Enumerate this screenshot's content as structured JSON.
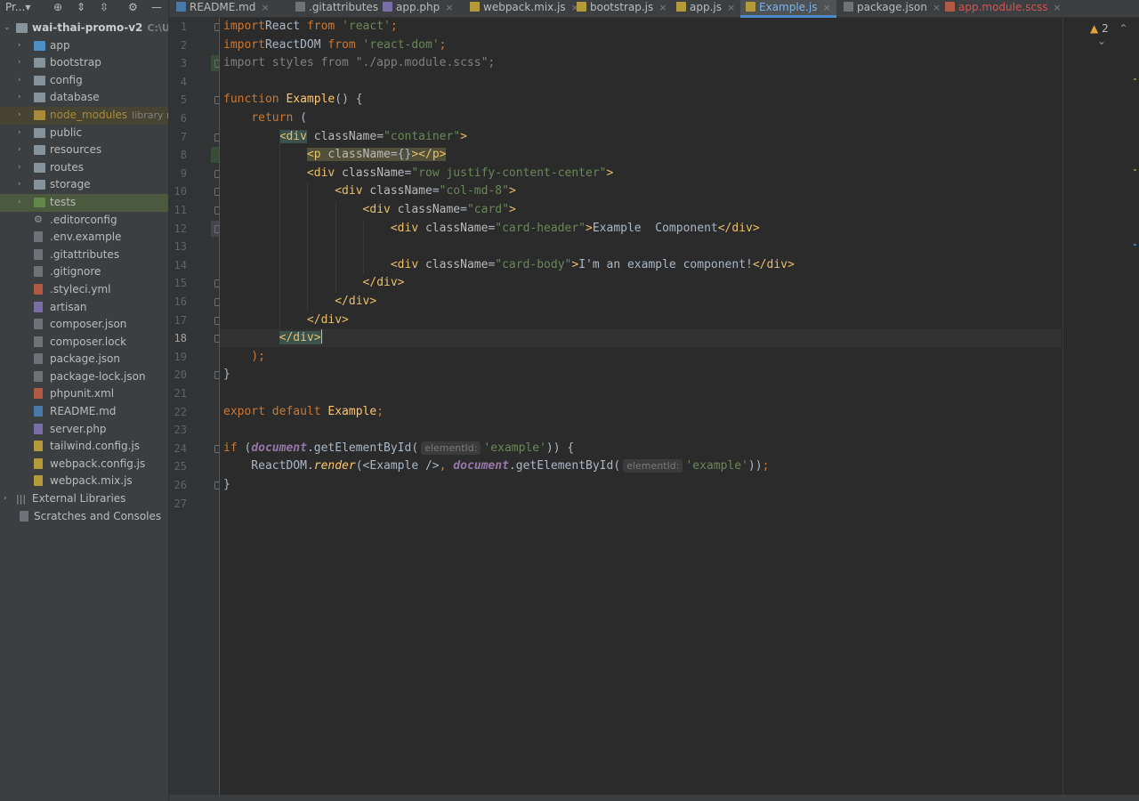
{
  "project_toolbar": {
    "title": "Pr...",
    "dropdown": "▾",
    "icons": [
      "target-icon",
      "expand-all-icon",
      "collapse-all-icon",
      "gear-icon",
      "hide-icon"
    ]
  },
  "tree": [
    {
      "label": "wai-thai-promo-v2",
      "sub": "C:\\Users",
      "indent": 0,
      "chevron": "⌄",
      "icon": "folder"
    },
    {
      "label": "app",
      "indent": 1,
      "chevron": "›",
      "icon": "folder-blue"
    },
    {
      "label": "bootstrap",
      "indent": 1,
      "chevron": "›",
      "icon": "folder"
    },
    {
      "label": "config",
      "indent": 1,
      "chevron": "›",
      "icon": "folder"
    },
    {
      "label": "database",
      "indent": 1,
      "chevron": "›",
      "icon": "folder"
    },
    {
      "label": "node_modules",
      "sub": "library roo",
      "indent": 1,
      "chevron": "›",
      "icon": "folder-orange",
      "excluded": true
    },
    {
      "label": "public",
      "indent": 1,
      "chevron": "›",
      "icon": "folder"
    },
    {
      "label": "resources",
      "indent": 1,
      "chevron": "›",
      "icon": "folder"
    },
    {
      "label": "routes",
      "indent": 1,
      "chevron": "›",
      "icon": "folder"
    },
    {
      "label": "storage",
      "indent": 1,
      "chevron": "›",
      "icon": "folder"
    },
    {
      "label": "tests",
      "indent": 1,
      "chevron": "›",
      "icon": "folder-green",
      "selected": true
    },
    {
      "label": ".editorconfig",
      "indent": 1,
      "icon": "gear"
    },
    {
      "label": ".env.example",
      "indent": 1,
      "icon": "file"
    },
    {
      "label": ".gitattributes",
      "indent": 1,
      "icon": "file"
    },
    {
      "label": ".gitignore",
      "indent": 1,
      "icon": "file"
    },
    {
      "label": ".styleci.yml",
      "indent": 1,
      "icon": "file-red"
    },
    {
      "label": "artisan",
      "indent": 1,
      "icon": "file-purple"
    },
    {
      "label": "composer.json",
      "indent": 1,
      "icon": "file"
    },
    {
      "label": "composer.lock",
      "indent": 1,
      "icon": "file"
    },
    {
      "label": "package.json",
      "indent": 1,
      "icon": "file"
    },
    {
      "label": "package-lock.json",
      "indent": 1,
      "icon": "file"
    },
    {
      "label": "phpunit.xml",
      "indent": 1,
      "icon": "file-red"
    },
    {
      "label": "README.md",
      "indent": 1,
      "icon": "file-blue"
    },
    {
      "label": "server.php",
      "indent": 1,
      "icon": "file-purple"
    },
    {
      "label": "tailwind.config.js",
      "indent": 1,
      "icon": "file-yellow"
    },
    {
      "label": "webpack.config.js",
      "indent": 1,
      "icon": "file-yellow"
    },
    {
      "label": "webpack.mix.js",
      "indent": 1,
      "icon": "file-yellow"
    },
    {
      "label": "External Libraries",
      "indent": 0,
      "chevron": "›",
      "icon": "libraries"
    },
    {
      "label": "Scratches and Consoles",
      "indent": 0,
      "icon": "scratches"
    }
  ],
  "tabs": [
    {
      "label": "README.md",
      "icon": "md",
      "color": "#4a78a8"
    },
    {
      "label": ".gitattributes",
      "icon": "file",
      "color": "#6f7378"
    },
    {
      "label": "app.php",
      "icon": "php",
      "color": "#7a6ea6"
    },
    {
      "label": "webpack.mix.js",
      "icon": "js",
      "color": "#b39b3c"
    },
    {
      "label": "bootstrap.js",
      "icon": "js",
      "color": "#b39b3c"
    },
    {
      "label": "app.js",
      "icon": "js",
      "color": "#b39b3c"
    },
    {
      "label": "Example.js",
      "icon": "js",
      "color": "#b39b3c",
      "active": true
    },
    {
      "label": "package.json",
      "icon": "json",
      "color": "#6f7378"
    },
    {
      "label": "app.module.scss",
      "icon": "scss",
      "color": "#b35a45",
      "error": true
    }
  ],
  "tab_close": "×",
  "editor": {
    "current_line": 18,
    "warnings_count": "2",
    "lines": [
      [
        [
          "kw",
          "import"
        ],
        [
          "",
          "React "
        ],
        [
          "kw",
          "from"
        ],
        [
          "str",
          " 'react'"
        ],
        [
          "kw",
          ";"
        ]
      ],
      [
        [
          "kw",
          "import"
        ],
        [
          "",
          "ReactDOM "
        ],
        [
          "kw",
          "from"
        ],
        [
          "str",
          " 'react-dom'"
        ],
        [
          "kw",
          ";"
        ]
      ],
      [
        [
          "dim",
          "import styles from \"./app.module.scss\";"
        ]
      ],
      [],
      [
        [
          "kw",
          "function "
        ],
        [
          "fn",
          "Example"
        ],
        [
          "",
          "() {"
        ]
      ],
      [
        [
          "",
          "    "
        ],
        [
          "kw",
          "return"
        ],
        [
          "",
          " ("
        ]
      ],
      [
        [
          "",
          "        "
        ],
        [
          "taghl",
          "<div"
        ],
        [
          "attr",
          " className"
        ],
        [
          "",
          "="
        ],
        [
          "str",
          "\"container\""
        ],
        [
          "tag",
          ">"
        ]
      ],
      [
        [
          "",
          "            "
        ],
        [
          "taghl2",
          "<p"
        ],
        [
          "attrhl2",
          " className"
        ],
        [
          "hl2",
          "="
        ],
        [
          "hl2",
          "{}"
        ],
        [
          "taghl2",
          "></p>"
        ]
      ],
      [
        [
          "",
          "            "
        ],
        [
          "tag",
          "<div"
        ],
        [
          "attr",
          " className"
        ],
        [
          "",
          "="
        ],
        [
          "str",
          "\"row justify-content-center\""
        ],
        [
          "tag",
          ">"
        ]
      ],
      [
        [
          "",
          "                "
        ],
        [
          "tag",
          "<div"
        ],
        [
          "attr",
          " className"
        ],
        [
          "",
          "="
        ],
        [
          "str",
          "\"col-md-8\""
        ],
        [
          "tag",
          ">"
        ]
      ],
      [
        [
          "",
          "                    "
        ],
        [
          "tag",
          "<div"
        ],
        [
          "attr",
          " className"
        ],
        [
          "",
          "="
        ],
        [
          "str",
          "\"card\""
        ],
        [
          "tag",
          ">"
        ]
      ],
      [
        [
          "",
          "                        "
        ],
        [
          "tag",
          "<div"
        ],
        [
          "attr",
          " className"
        ],
        [
          "",
          "="
        ],
        [
          "str",
          "\"card-header\""
        ],
        [
          "tag",
          ">"
        ],
        [
          "",
          "Example  Component"
        ],
        [
          "tag",
          "</div>"
        ]
      ],
      [],
      [
        [
          "",
          "                        "
        ],
        [
          "tag",
          "<div"
        ],
        [
          "attr",
          " className"
        ],
        [
          "",
          "="
        ],
        [
          "str",
          "\"card-body\""
        ],
        [
          "tag",
          ">"
        ],
        [
          "",
          "I'm an example component!"
        ],
        [
          "tag",
          "</div>"
        ]
      ],
      [
        [
          "",
          "                    "
        ],
        [
          "tag",
          "</div>"
        ]
      ],
      [
        [
          "",
          "                "
        ],
        [
          "tag",
          "</div>"
        ]
      ],
      [
        [
          "",
          "            "
        ],
        [
          "tag",
          "</div>"
        ]
      ],
      [
        [
          "",
          "        "
        ],
        [
          "taghl",
          "</div>"
        ],
        [
          "caret",
          ""
        ]
      ],
      [
        [
          "",
          "    "
        ],
        [
          "kw",
          ");"
        ]
      ],
      [
        [
          "",
          "}"
        ]
      ],
      [],
      [
        [
          "kw",
          "export default "
        ],
        [
          "fn",
          "Example"
        ],
        [
          "kw",
          ";"
        ]
      ],
      [],
      [
        [
          "kw",
          "if "
        ],
        [
          "",
          "("
        ],
        [
          "ital",
          "document"
        ],
        [
          "",
          ".getElementById("
        ],
        [
          "hint",
          "elementId:"
        ],
        [
          "str",
          "'example'"
        ],
        [
          "",
          "))"
        ],
        [
          "",
          " {"
        ]
      ],
      [
        [
          "",
          "    ReactDOM."
        ],
        [
          "italfn",
          "render"
        ],
        [
          "",
          "(<Example />"
        ],
        [
          "kw",
          ", "
        ],
        [
          "ital",
          "document"
        ],
        [
          "",
          ".getElementById("
        ],
        [
          "hint",
          "elementId:"
        ],
        [
          "str",
          "'example'"
        ],
        [
          "",
          "))"
        ],
        [
          "kw",
          ";"
        ]
      ],
      [
        [
          "",
          "}"
        ]
      ],
      []
    ]
  }
}
